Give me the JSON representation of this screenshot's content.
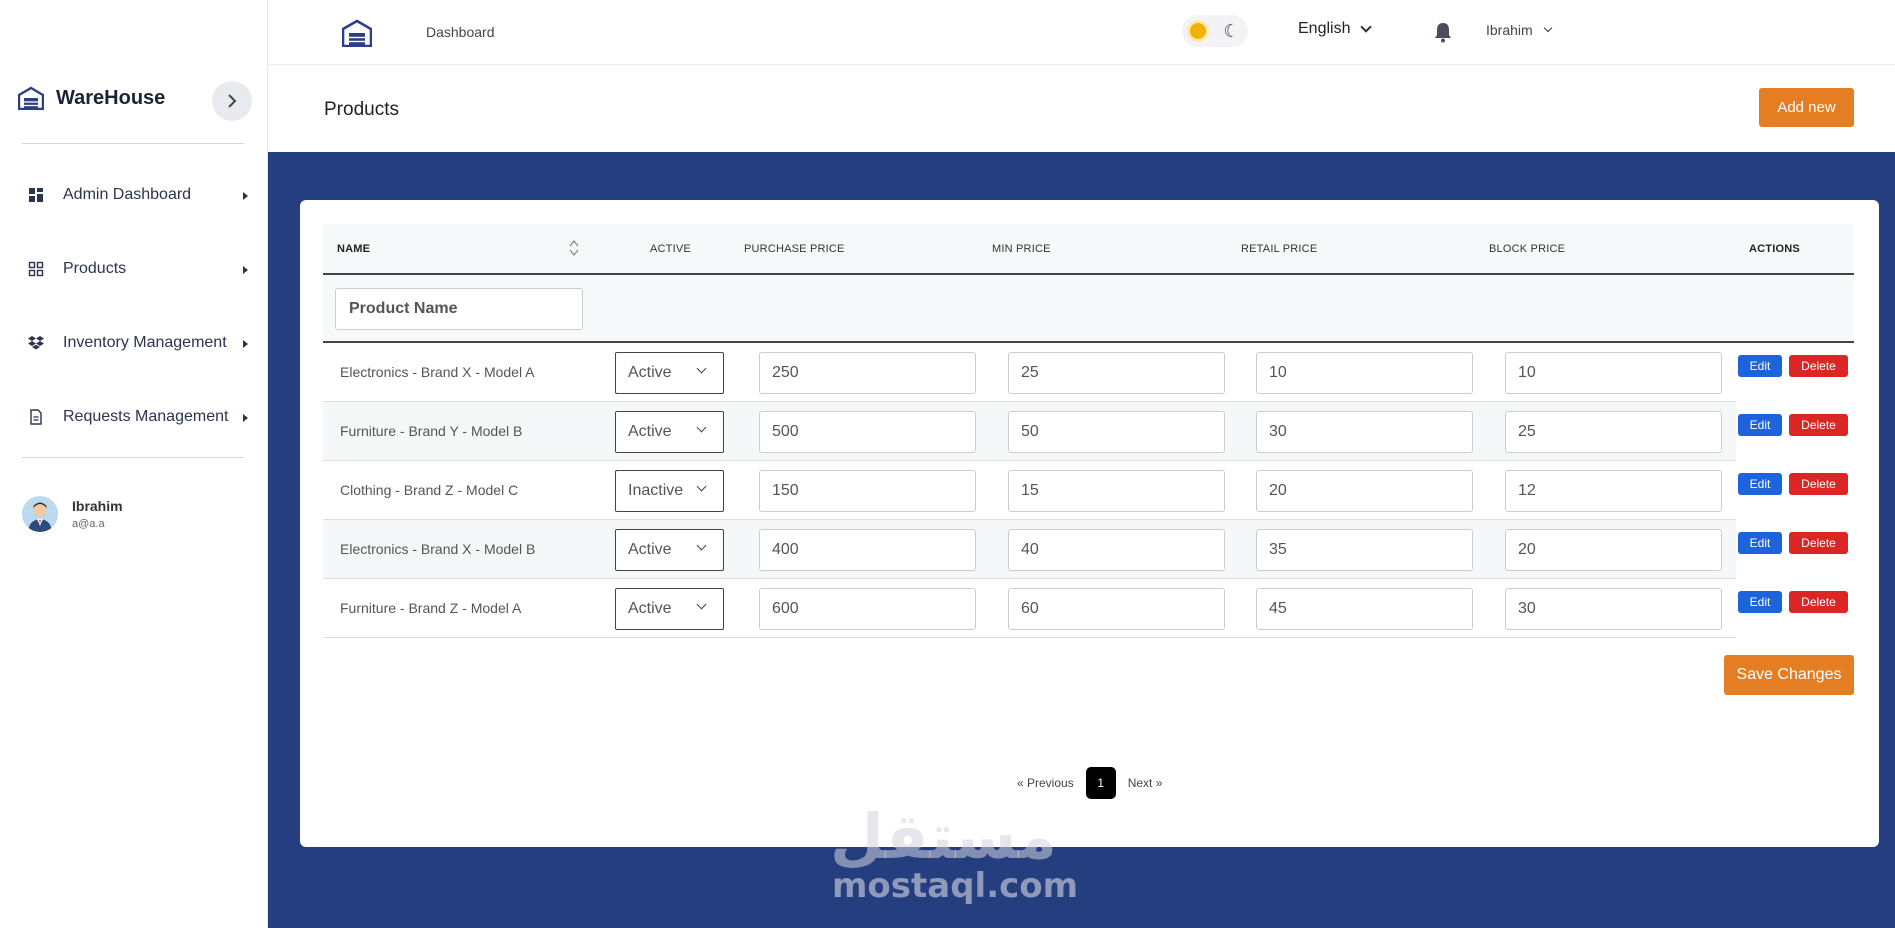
{
  "sidebar": {
    "brand": "WareHouse",
    "nav": [
      {
        "label": "Admin Dashboard",
        "icon": "grid-icon"
      },
      {
        "label": "Products",
        "icon": "apps-icon"
      },
      {
        "label": "Inventory Management",
        "icon": "dropbox-icon"
      },
      {
        "label": "Requests Management",
        "icon": "document-icon"
      }
    ],
    "user": {
      "name": "Ibrahim",
      "email": "a@a.a"
    }
  },
  "topbar": {
    "breadcrumb": "Dashboard",
    "language": "English",
    "user": "Ibrahim",
    "moon": "☾"
  },
  "page": {
    "title": "Products",
    "add_new": "Add new",
    "save_changes": "Save Changes"
  },
  "table": {
    "headers": {
      "name": "NAME",
      "active": "ACTIVE",
      "purchase": "PURCHASE PRICE",
      "min": "MIN PRICE",
      "retail": "RETAIL PRICE",
      "block": "BLOCK PRICE",
      "actions": "ACTIONS"
    },
    "filter_placeholder": "Product Name",
    "edit_label": "Edit",
    "delete_label": "Delete",
    "rows": [
      {
        "name": "Electronics - Brand X - Model A",
        "status": "Active",
        "purchase": "250",
        "min": "25",
        "retail": "10",
        "block": "10"
      },
      {
        "name": "Furniture - Brand Y - Model B",
        "status": "Active",
        "purchase": "500",
        "min": "50",
        "retail": "30",
        "block": "25"
      },
      {
        "name": "Clothing - Brand Z - Model C",
        "status": "Inactive",
        "purchase": "150",
        "min": "15",
        "retail": "20",
        "block": "12"
      },
      {
        "name": "Electronics - Brand X - Model B",
        "status": "Active",
        "purchase": "400",
        "min": "40",
        "retail": "35",
        "block": "20"
      },
      {
        "name": "Furniture - Brand Z - Model A",
        "status": "Active",
        "purchase": "600",
        "min": "60",
        "retail": "45",
        "block": "30"
      }
    ]
  },
  "pagination": {
    "previous": "« Previous",
    "current": "1",
    "next": "Next »"
  },
  "watermark": {
    "arabic": "مستقل",
    "latin": "mostaql.com"
  },
  "colors": {
    "accent": "#e57e22",
    "content_bg": "#243e80",
    "edit": "#1d64dc",
    "delete": "#dc2626"
  }
}
